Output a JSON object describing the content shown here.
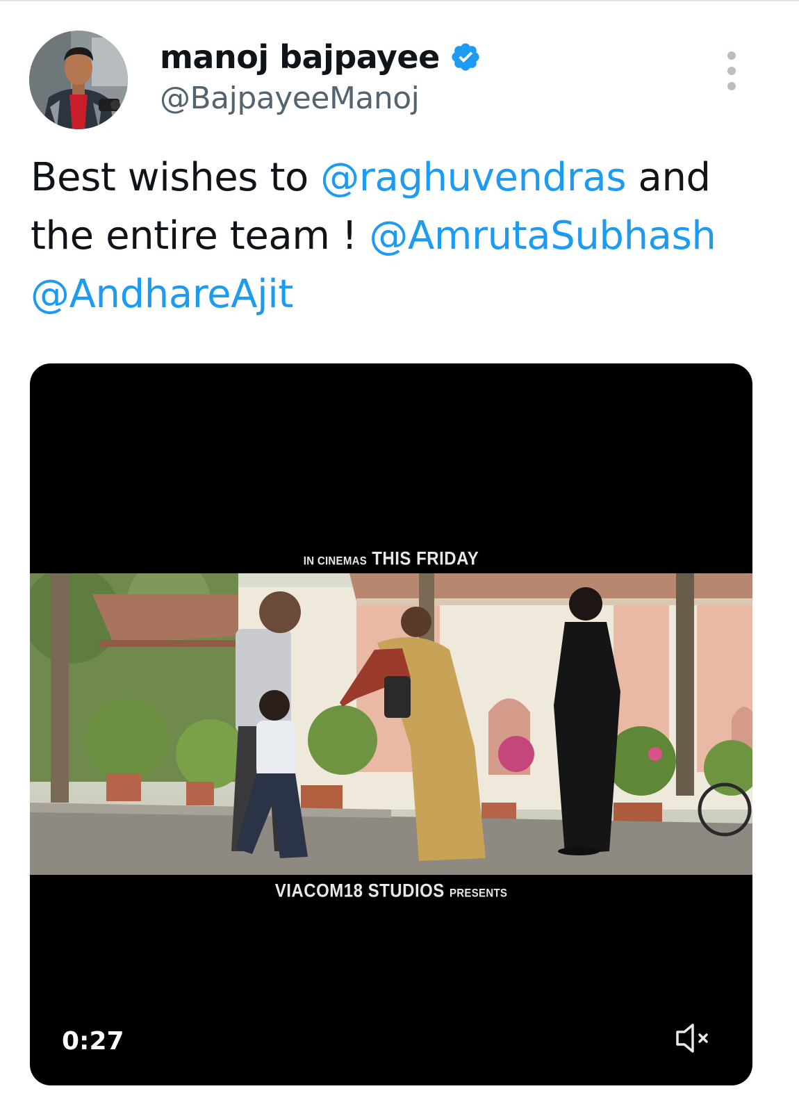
{
  "tweet": {
    "author": {
      "display_name": "manoj bajpayee",
      "handle": "@BajpayeeManoj",
      "verified": true,
      "avatar_icon": "profile-photo"
    },
    "more_icon": "more-vertical-icon",
    "text": {
      "line1_prefix": "Best wishes to ",
      "mention1": "@raghuvendras",
      "line1_suffix": " and",
      "line2_prefix": "the entire team ! ",
      "mention2": "@AmrutaSubhash",
      "mention3": "@AndhareAjit"
    },
    "colors": {
      "mention": "#1d9bf0",
      "text": "#0f1419",
      "handle": "#536471",
      "verified_badge": "#1d9bf0"
    },
    "media": {
      "type": "video",
      "caption_top_small": "IN CINEMAS",
      "caption_top_large": "THIS FRIDAY",
      "caption_bottom_large": "VIACOM18 STUDIOS",
      "caption_bottom_small": "PRESENTS",
      "duration": "0:27",
      "mute_icon": "volume-muted-icon"
    }
  }
}
